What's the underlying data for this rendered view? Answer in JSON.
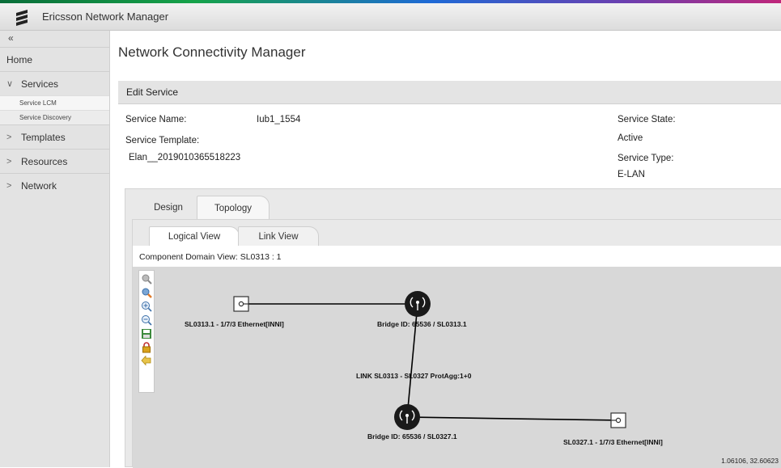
{
  "app": {
    "title": "Ericsson Network Manager"
  },
  "sidebar": {
    "collapse": "«",
    "items": [
      {
        "label": "Home",
        "chevron": ""
      },
      {
        "label": "Services",
        "chevron": "∨"
      },
      {
        "label": "Templates",
        "chevron": ">"
      },
      {
        "label": "Resources",
        "chevron": ">"
      },
      {
        "label": "Network",
        "chevron": ">"
      }
    ],
    "subitems": [
      "Service LCM",
      "Service Discovery"
    ]
  },
  "page": {
    "title": "Network Connectivity Manager",
    "panel_title": "Edit Service"
  },
  "service": {
    "name_label": "Service Name:",
    "name_value": "Iub1_1554",
    "template_label": "Service Template:",
    "template_value": "Elan__2019010365518223",
    "state_label": "Service State:",
    "state_value": "Active",
    "type_label": "Service Type:",
    "type_value": "E-LAN"
  },
  "tabs": {
    "outer": [
      "Design",
      "Topology"
    ],
    "inner": [
      "Logical View",
      "Link View"
    ]
  },
  "topology": {
    "domain_view": "Component Domain View: SL0313 : 1",
    "labels": {
      "port1": "SL0313.1 - 1/7/3 Ethernet[INNI]",
      "bridge1": "Bridge ID: 65536 / SL0313.1",
      "link": "LINK SL0313 - SL0327 ProtAgg:1+0",
      "bridge2": "Bridge ID: 65536 / SL0327.1",
      "port2": "SL0327.1 - 1/7/3 Ethernet[INNI]"
    },
    "coords": "1.06106, 32.60623",
    "toolbar_icons": [
      "zoom-fit-icon",
      "search-icon",
      "zoom-in-icon",
      "zoom-out-icon",
      "save-icon",
      "lock-icon",
      "back-icon"
    ]
  }
}
